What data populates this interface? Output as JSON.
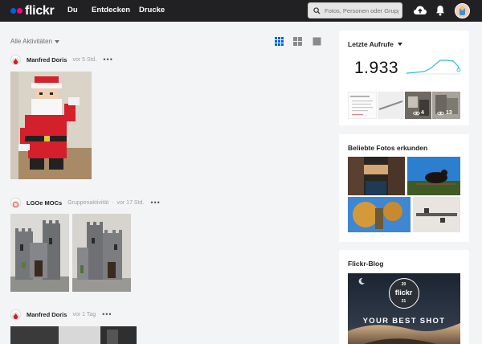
{
  "topbar": {
    "brand": "flickr",
    "nav": [
      {
        "label": "Du"
      },
      {
        "label": "Entdecken"
      },
      {
        "label": "Drucke"
      }
    ],
    "search_placeholder": "Fotos, Personen oder Gruppen"
  },
  "feed": {
    "filter_label": "Alle Aktivitäten",
    "posts": [
      {
        "author": "Manfred Doris",
        "group": "",
        "time": "vor 5 Std.",
        "more": "•••"
      },
      {
        "author": "LGOe MOCs",
        "group": "Gruppenaktivität",
        "separator": "·",
        "time": "vor 17 Std.",
        "more": "•••"
      },
      {
        "author": "Manfred Doris",
        "group": "",
        "time": "vor 1 Tag",
        "more": "•••"
      }
    ]
  },
  "sidebar": {
    "recent": {
      "title": "Letzte Aufrufe",
      "count": "1.933",
      "thumb_views": [
        "4",
        "13"
      ]
    },
    "explore": {
      "title": "Beliebte Fotos erkunden"
    },
    "blog": {
      "title": "Flickr-Blog",
      "badge_top": "20",
      "badge_brand": "flickr",
      "badge_bottom": "21",
      "headline": "YOUR BEST SHOT"
    }
  },
  "colors": {
    "topbar": "#212124",
    "brand_blue": "#0063dc",
    "brand_pink": "#ff0084",
    "sparkline": "#3cb8e6"
  }
}
